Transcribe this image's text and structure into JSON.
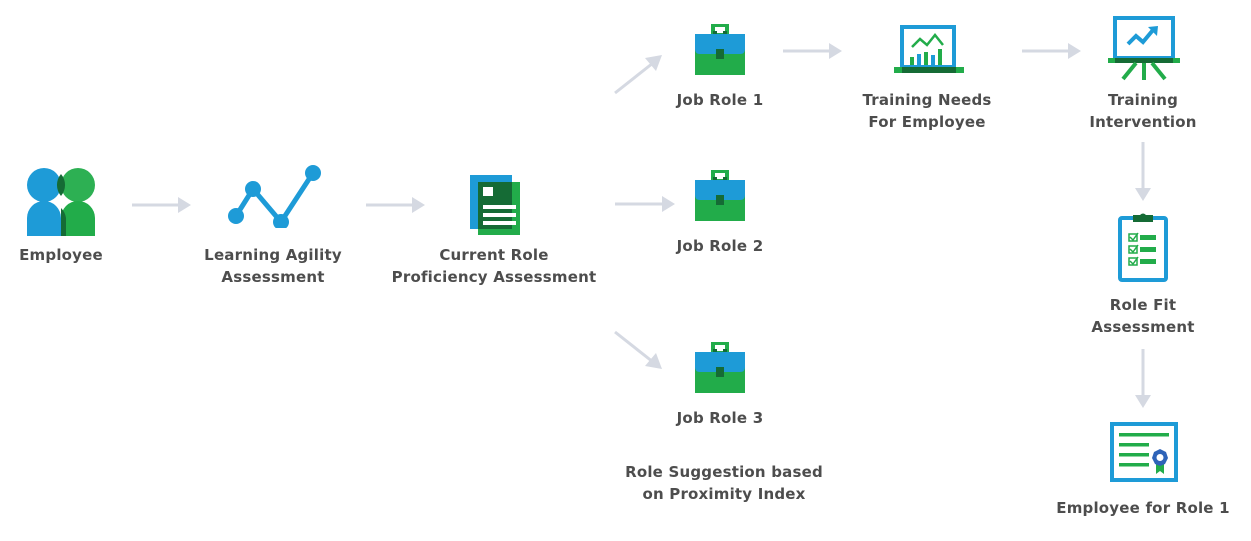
{
  "colors": {
    "blue": "#1e9bd7",
    "green": "#22ac4a",
    "dark_green": "#156b35",
    "arrow": "#d5d9e2",
    "text": "#4d4d4d"
  },
  "nodes": {
    "employee": {
      "label": "Employee",
      "icon": "people-icon"
    },
    "learning_agility": {
      "label_line1": "Learning Agility",
      "label_line2": "Assessment",
      "icon": "line-chart-icon"
    },
    "current_role": {
      "label_line1": "Current Role",
      "label_line2": "Proficiency Assessment",
      "icon": "document-icon"
    },
    "job_role_1": {
      "label": "Job Role 1",
      "icon": "briefcase-icon"
    },
    "job_role_2": {
      "label": "Job Role 2",
      "icon": "briefcase-icon"
    },
    "job_role_3": {
      "label": "Job Role 3",
      "icon": "briefcase-icon"
    },
    "role_suggestion": {
      "label_line1": "Role Suggestion based",
      "label_line2": "on Proximity Index"
    },
    "training_needs": {
      "label_line1": "Training Needs",
      "label_line2": "For Employee",
      "icon": "laptop-chart-icon"
    },
    "training_intervention": {
      "label_line1": "Training",
      "label_line2": "Intervention",
      "icon": "presentation-board-icon"
    },
    "role_fit": {
      "label_line1": "Role Fit",
      "label_line2": "Assessment",
      "icon": "clipboard-checklist-icon"
    },
    "employee_for_role": {
      "label": "Employee for Role 1",
      "icon": "certificate-icon"
    }
  },
  "edges": [
    {
      "from": "employee",
      "to": "learning_agility"
    },
    {
      "from": "learning_agility",
      "to": "current_role"
    },
    {
      "from": "current_role",
      "to": "job_role_1"
    },
    {
      "from": "current_role",
      "to": "job_role_2"
    },
    {
      "from": "current_role",
      "to": "job_role_3"
    },
    {
      "from": "job_role_1",
      "to": "training_needs"
    },
    {
      "from": "training_needs",
      "to": "training_intervention"
    },
    {
      "from": "training_intervention",
      "to": "role_fit"
    },
    {
      "from": "role_fit",
      "to": "employee_for_role"
    }
  ]
}
